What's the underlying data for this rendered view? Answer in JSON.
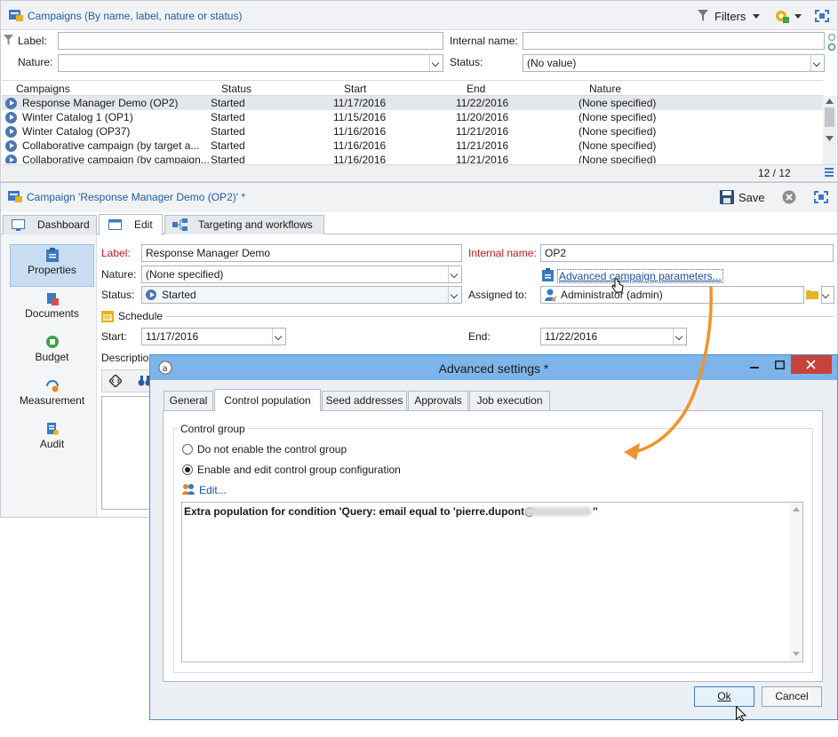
{
  "list_panel": {
    "title": "Campaigns (By name, label, nature or status)",
    "filters_label": "Filters",
    "label_label": "Label:",
    "label_value": "",
    "internal_name_label": "Internal name:",
    "internal_name_value": "",
    "nature_label": "Nature:",
    "nature_value": "",
    "status_label": "Status:",
    "status_value": "(No value)",
    "columns": [
      "Campaigns",
      "Status",
      "Start",
      "End",
      "Nature"
    ],
    "rows": [
      {
        "name": "Response Manager Demo (OP2)",
        "status": "Started",
        "start": "11/17/2016",
        "end": "11/22/2016",
        "nature": "(None specified)"
      },
      {
        "name": "Winter Catalog 1 (OP1)",
        "status": "Started",
        "start": "11/15/2016",
        "end": "11/20/2016",
        "nature": "(None specified)"
      },
      {
        "name": "Winter Catalog (OP37)",
        "status": "Started",
        "start": "11/16/2016",
        "end": "11/21/2016",
        "nature": "(None specified)"
      },
      {
        "name": "Collaborative campaign (by target a...",
        "status": "Started",
        "start": "11/16/2016",
        "end": "11/21/2016",
        "nature": "(None specified)"
      },
      {
        "name": "Collaborative campaign (by campaign...",
        "status": "Started",
        "start": "11/16/2016",
        "end": "11/21/2016",
        "nature": "(None specified)"
      }
    ],
    "count": "12 / 12"
  },
  "detail": {
    "title": "Campaign 'Response Manager Demo (OP2)' *",
    "save_label": "Save",
    "tabs": [
      "Dashboard",
      "Edit",
      "Targeting and workflows"
    ],
    "sidebar": [
      "Properties",
      "Documents",
      "Budget",
      "Measurement",
      "Audit"
    ],
    "label_label": "Label:",
    "label_value": "Response Manager Demo",
    "internal_name_label": "Internal name:",
    "internal_name_value": "OP2",
    "nature_label": "Nature:",
    "nature_value": "(None specified)",
    "advanced_link": "Advanced campaign parameters...",
    "status_label": "Status:",
    "status_value": "Started",
    "assigned_label": "Assigned to:",
    "assigned_value": "Administrator (admin)",
    "schedule_label": "Schedule",
    "start_label": "Start:",
    "start_value": "11/17/2016",
    "end_label": "End:",
    "end_value": "11/22/2016",
    "description_label": "Descriptio"
  },
  "dialog": {
    "title": "Advanced settings *",
    "tabs": [
      "General",
      "Control population",
      "Seed addresses",
      "Approvals",
      "Job execution"
    ],
    "group_label": "Control group",
    "option1": "Do not enable the control group",
    "option2": "Enable and edit control group configuration",
    "edit_link": "Edit...",
    "text_content": "Extra population for condition 'Query: email equal to 'pierre.dupont@",
    "text_tail": "''",
    "ok_label": "Ok",
    "cancel_label": "Cancel"
  },
  "colors": {
    "accent": "#1f6fb5",
    "arrow": "#f0932b",
    "required": "#c0161b",
    "dialog_border": "#4a8fd8"
  }
}
